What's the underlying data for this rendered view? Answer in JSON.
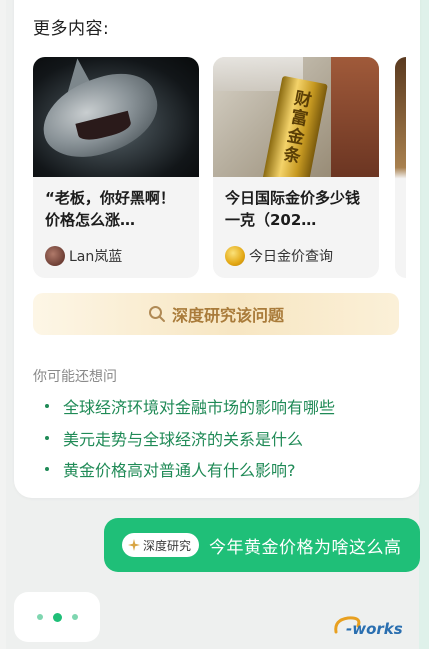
{
  "section": {
    "title": "更多内容:"
  },
  "recommendations": [
    {
      "title": "“老板，你好黑啊！价格怎么涨…",
      "author": "Lan岚蓝",
      "image": "shark-photo"
    },
    {
      "title": "今日国际金价多少钱一克（202…",
      "author": "今日金价查询",
      "image": "gold-bar-photo",
      "image_text": "财富金条"
    }
  ],
  "research_button": {
    "label": "深度研究该问题"
  },
  "suggestions": {
    "label": "你可能还想问",
    "items": [
      "全球经济环境对金融市场的影响有哪些",
      "美元走势与全球经济的关系是什么",
      "黄金价格高对普通人有什么影响?"
    ]
  },
  "user_message": {
    "tag": "深度研究",
    "text": "今年黄金价格为啥这么高"
  },
  "watermark": {
    "text": "e-works"
  },
  "colors": {
    "accent_green": "#1fbf78",
    "link_green": "#1f8a56",
    "gold_text": "#a97b3a"
  }
}
